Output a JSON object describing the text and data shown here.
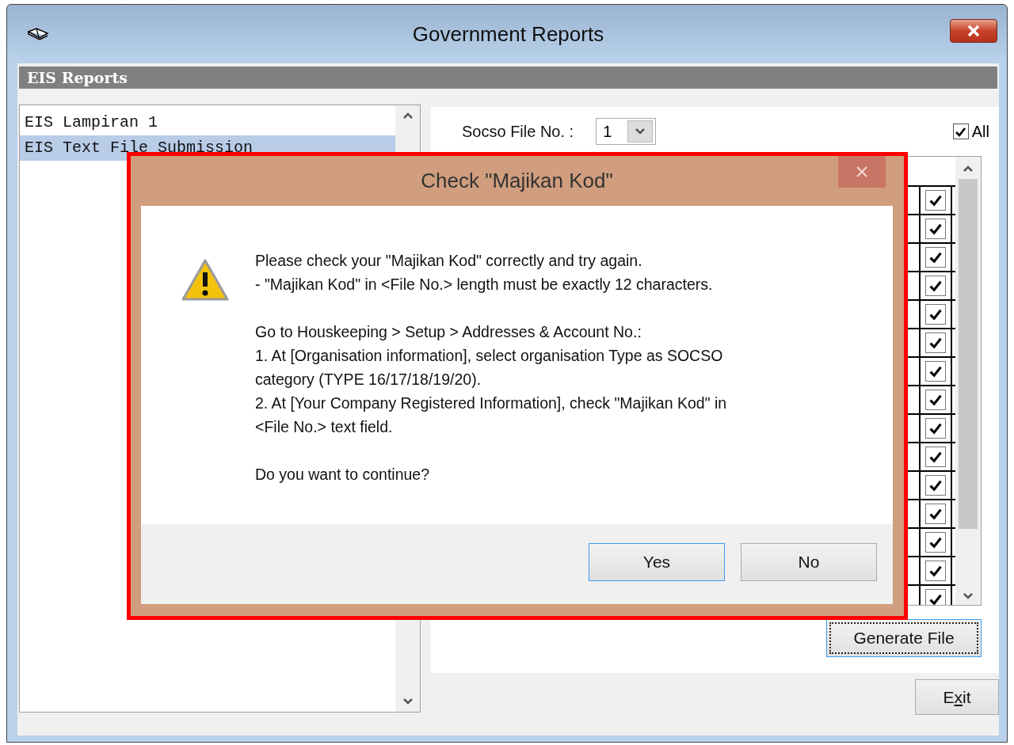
{
  "window": {
    "title": "Government Reports"
  },
  "section_header": "EIS Reports",
  "report_list": {
    "items": [
      {
        "label": "EIS Lampiran 1",
        "selected": false
      },
      {
        "label": "EIS Text File Submission",
        "selected": true
      }
    ]
  },
  "socso_file": {
    "label": "Socso File No. :",
    "value": "1"
  },
  "all_checkbox": {
    "label": "All",
    "checked": true
  },
  "grid_rows": [
    {
      "checked": true
    },
    {
      "checked": true
    },
    {
      "checked": true
    },
    {
      "checked": true
    },
    {
      "checked": true
    },
    {
      "checked": true
    },
    {
      "checked": true
    },
    {
      "checked": true
    },
    {
      "checked": true
    },
    {
      "checked": true
    },
    {
      "checked": true
    },
    {
      "checked": true
    },
    {
      "checked": true
    },
    {
      "checked": true
    },
    {
      "checked": true
    }
  ],
  "generate_button": {
    "label": "Generate File",
    "focused": true
  },
  "exit_button": {
    "label_before_key": "E",
    "access_key": "x",
    "label_after_key": "it"
  },
  "dialog": {
    "title": "Check \"Majikan Kod\"",
    "message": [
      {
        "lines": [
          "Please check your \"Majikan Kod\" correctly and try again.",
          "- \"Majikan Kod\" in <File No.> length must be exactly 12 characters."
        ]
      },
      {
        "lines": [
          "Go to Houskeeping > Setup > Addresses & Account No.:",
          "1. At [Organisation information], select organisation Type as SOCSO",
          "category (TYPE 16/17/18/19/20).",
          "2. At [Your Company Registered Information], check \"Majikan Kod\" in",
          "<File No.> text field."
        ]
      },
      {
        "lines": [
          "Do you want to continue?"
        ]
      }
    ],
    "buttons": [
      {
        "label": "Yes",
        "default": true
      },
      {
        "label": "No",
        "default": false
      }
    ]
  }
}
